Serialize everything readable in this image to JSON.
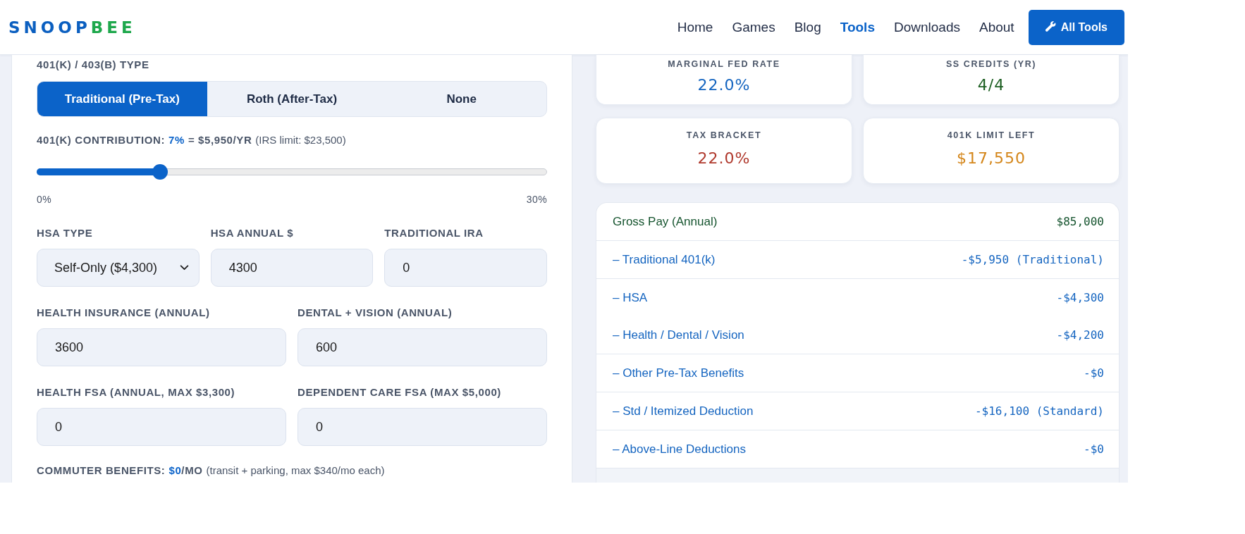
{
  "header": {
    "logo": [
      {
        "text": "SNOOP",
        "color": "#0b5fc0"
      },
      {
        "text": "BEE",
        "color": "#1ea84c"
      }
    ],
    "nav": [
      {
        "label": "Home",
        "selected": false
      },
      {
        "label": "Games",
        "selected": false
      },
      {
        "label": "Blog",
        "selected": false
      },
      {
        "label": "Tools",
        "selected": true
      },
      {
        "label": "Downloads",
        "selected": false
      },
      {
        "label": "About",
        "selected": false
      }
    ],
    "button": {
      "label": "All Tools"
    }
  },
  "retirement": {
    "type_label": "401(K) / 403(B) TYPE",
    "type_options": [
      {
        "label": "Traditional (Pre-Tax)",
        "selected": true
      },
      {
        "label": "Roth (After-Tax)",
        "selected": false
      },
      {
        "label": "None",
        "selected": false
      }
    ],
    "contribution": {
      "label": "401(K) CONTRIBUTION:",
      "percent": "7%",
      "amount": "= $5,950/YR",
      "note": "(IRS limit: $23,500)",
      "level": 0.2333,
      "min_label": "0%",
      "max_label": "30%"
    }
  },
  "field_rows": [
    {
      "fields": [
        {
          "kind": "select",
          "label": "HSA TYPE",
          "value": "Self-Only ($4,300)"
        },
        {
          "kind": "input",
          "label": "HSA ANNUAL $",
          "value": "4300"
        },
        {
          "kind": "input",
          "label": "TRADITIONAL IRA",
          "value": "0"
        }
      ]
    },
    {
      "fields": [
        {
          "kind": "input",
          "label": "HEALTH INSURANCE (ANNUAL)",
          "value": "3600"
        },
        {
          "kind": "input",
          "label": "DENTAL + VISION (ANNUAL)",
          "value": "600"
        }
      ]
    },
    {
      "fields": [
        {
          "kind": "input",
          "label": "HEALTH FSA (ANNUAL, MAX $3,300)",
          "value": "0"
        },
        {
          "kind": "input",
          "label": "DEPENDENT CARE FSA (MAX $5,000)",
          "value": "0"
        }
      ]
    }
  ],
  "commuter": {
    "label": "COMMUTER BENEFITS:",
    "value": "$0",
    "unit": "/MO",
    "note": "(transit + parking, max $340/mo each)"
  },
  "stats": [
    {
      "label": "MARGINAL FED RATE",
      "value": "22.0%",
      "color": "#1565c0"
    },
    {
      "label": "SS CREDITS (YR)",
      "value": "4/4",
      "color": "#1b5e20"
    },
    {
      "label": "TAX BRACKET",
      "value": "22.0%",
      "color": "#b03a2e"
    },
    {
      "label": "401K LIMIT LEFT",
      "value": "$17,550",
      "color": "#d4861a"
    }
  ],
  "breakdown": {
    "groups": [
      {
        "rows": [
          {
            "kind": "income",
            "label": "Gross Pay (Annual)",
            "value": "$85,000"
          }
        ]
      },
      {
        "rows": [
          {
            "kind": "deduction",
            "label": "– Traditional 401(k)",
            "value": "-$5,950 (Traditional)"
          }
        ]
      },
      {
        "rows": [
          {
            "kind": "deduction",
            "label": "– HSA",
            "value": "-$4,300"
          },
          {
            "kind": "deduction",
            "label": "– Health / Dental / Vision",
            "value": "-$4,200"
          }
        ]
      },
      {
        "rows": [
          {
            "kind": "deduction",
            "label": "– Other Pre-Tax Benefits",
            "value": "-$0"
          }
        ]
      },
      {
        "rows": [
          {
            "kind": "deduction",
            "label": "– Std / Itemized Deduction",
            "value": "-$16,100 (Standard)"
          }
        ]
      },
      {
        "rows": [
          {
            "kind": "deduction",
            "label": "– Above-Line Deductions",
            "value": "-$0"
          }
        ]
      }
    ]
  }
}
